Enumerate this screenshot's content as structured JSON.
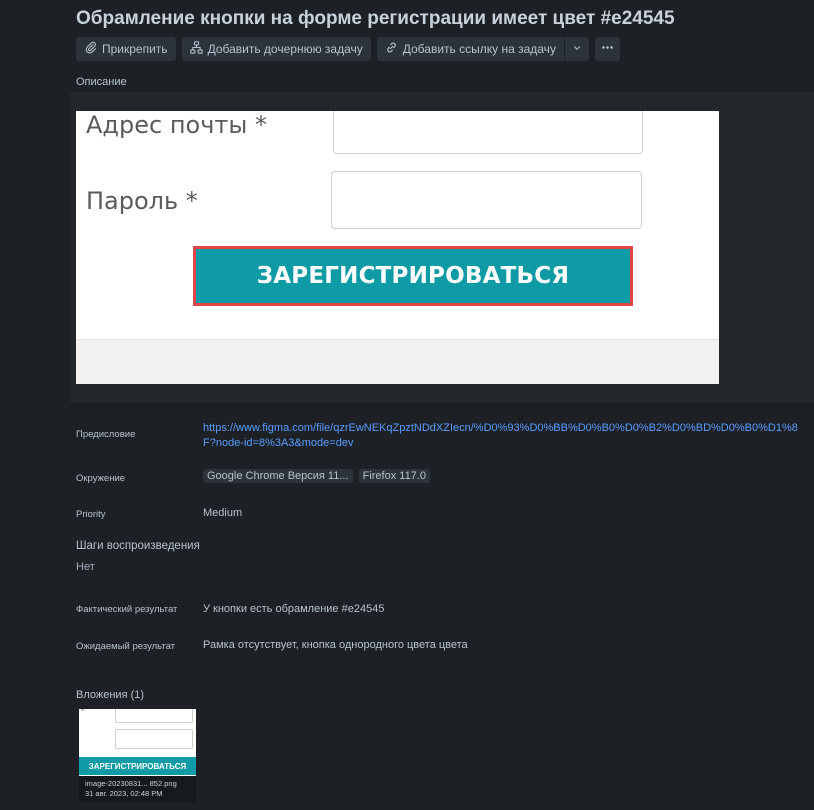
{
  "issue": {
    "title": "Обрамление кнопки на форме регистрации имеет цвет #e24545"
  },
  "toolbar": {
    "attach_label": "Прикрепить",
    "add_child_label": "Добавить дочернюю задачу",
    "add_link_label": "Добавить ссылку на задачу",
    "caret_icon": "chevron-down-icon",
    "more_icon": "more-icon"
  },
  "description": {
    "label": "Описание",
    "screenshot": {
      "email_label": "Адрес почты *",
      "password_label": "Пароль *",
      "register_button": "ЗАРЕГИСТРИРОВАТЬСЯ",
      "button_color": "#0e9ba6",
      "outline_color": "#e24545"
    }
  },
  "fields": {
    "preface": {
      "label": "Предисловие",
      "value": "https://www.figma.com/file/qzrEwNEKqZpztNDdXZIecn/%D0%93%D0%BB%D0%B0%D0%B2%D0%BD%D0%B0%D1%8F?node-id=8%3A3&mode=dev"
    },
    "environment": {
      "label": "Окружение",
      "tags": [
        "Google Chrome Версия 11...",
        "Firefox 117.0"
      ]
    },
    "priority": {
      "label": "Priority",
      "value": "Medium"
    },
    "steps": {
      "label": "Шаги воспроизведения",
      "value": "Нет"
    },
    "actual": {
      "label": "Фактический результат",
      "value": "У кнопки есть обрамление #e24545"
    },
    "expected": {
      "label": "Ожидаемый результат",
      "value": "Рамка отсутствует, кнопка однородного цвета цвета"
    }
  },
  "attachments": {
    "heading": "Вложения (1)",
    "items": [
      {
        "thumb_star": "*",
        "thumb_button": "ЗАРЕГИСТРИРОВАТЬСЯ",
        "name": "image-20230831... 852.png",
        "date": "31 авг. 2023, 02:48 PM"
      }
    ]
  },
  "colors": {
    "background": "#1d2125",
    "link": "#579dff",
    "accent_outline": "#e24545",
    "button_teal": "#0e9ba6"
  }
}
